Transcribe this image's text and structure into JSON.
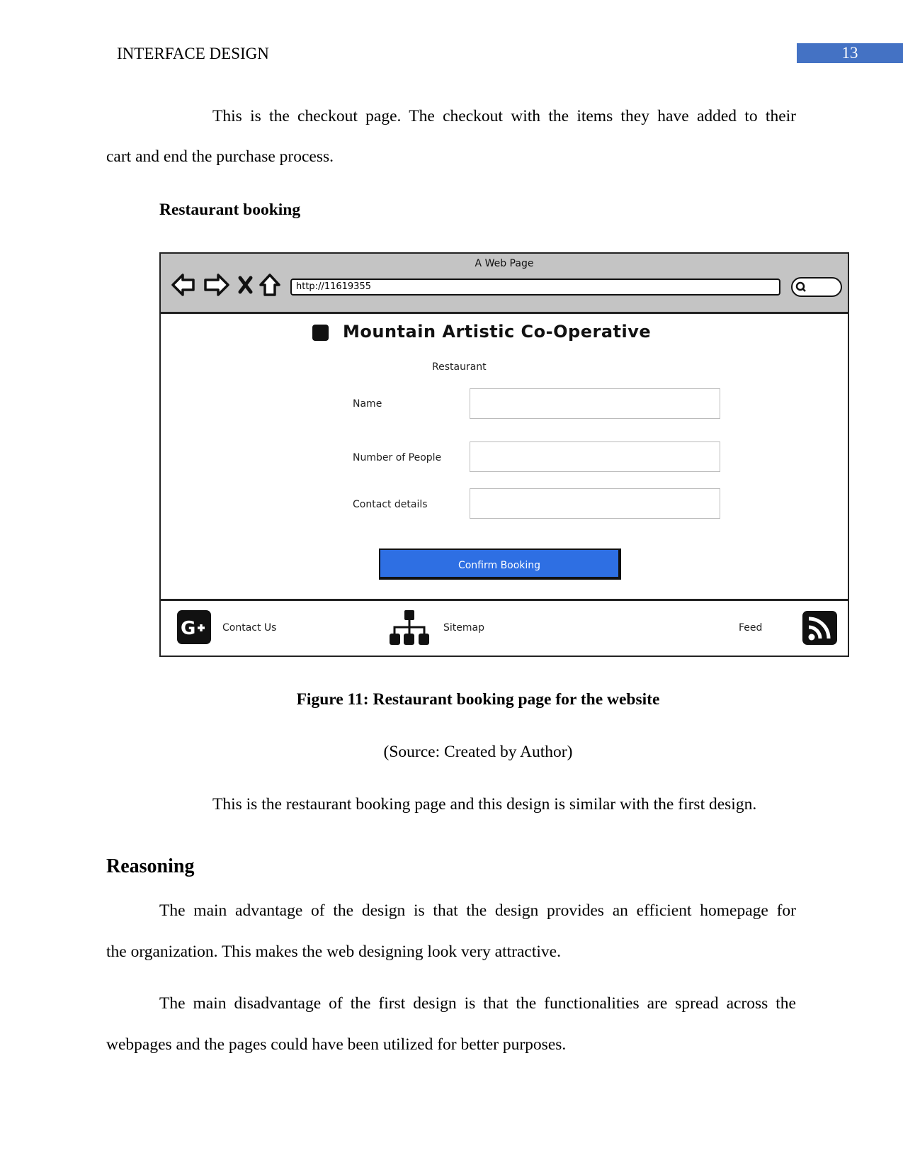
{
  "header": {
    "running_head": "INTERFACE DESIGN",
    "page_number": "13",
    "accent_color": "#4472c4"
  },
  "intro_paragraph": {
    "line1": "This is the checkout page. The checkout with the items they have added to their",
    "line2": "cart and end the purchase process."
  },
  "section_heading": "Restaurant booking",
  "wireframe": {
    "window_title": "A Web Page",
    "url": "http://11619355",
    "toolbar_icons": [
      "back-arrow-icon",
      "forward-arrow-icon",
      "close-x-icon",
      "home-icon",
      "search-icon"
    ],
    "site_title": "Mountain Artistic Co-Operative",
    "form_heading": "Restaurant",
    "fields": [
      {
        "label": "Name",
        "value": ""
      },
      {
        "label": "Number of People",
        "value": ""
      },
      {
        "label": "Contact details",
        "value": ""
      }
    ],
    "confirm_button": "Confirm Booking",
    "button_color": "#2e6fe3",
    "footer": {
      "contact_label": "Contact Us",
      "sitemap_label": "Sitemap",
      "feed_label": "Feed",
      "icons": [
        "google-plus-icon",
        "sitemap-icon",
        "rss-icon"
      ]
    }
  },
  "figure": {
    "caption": "Figure 11: Restaurant booking page for the website",
    "source": "(Source: Created by Author)"
  },
  "after_figure_paragraph": "This is the restaurant booking page and this design is similar with the first design.",
  "reasoning": {
    "heading": "Reasoning",
    "para1_line1": "The main advantage of the design is that the design provides an efficient homepage for",
    "para1_line2": "the organization. This makes the web designing look very attractive.",
    "para2_line1": "The main disadvantage of the first design is that the functionalities are spread across the",
    "para2_line2": "webpages and the pages could have been utilized for better purposes."
  }
}
